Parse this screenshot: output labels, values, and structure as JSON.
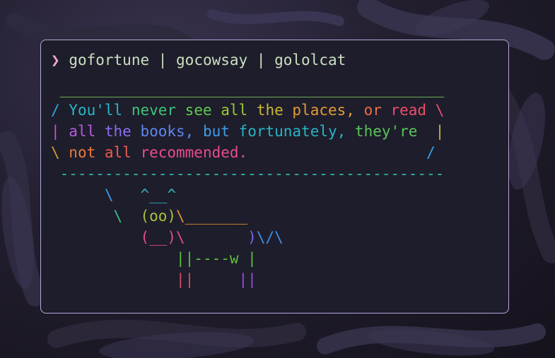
{
  "terminal": {
    "prompt_symbol": "❯",
    "command": "gofortune | gocowsay | gololcat"
  },
  "output_lines": [
    [
      {
        "t": " ",
        "c": "#6ec45a"
      },
      {
        "t": "___________________________________________",
        "c": "#7bc85a"
      }
    ],
    [
      {
        "t": "/ ",
        "c": "#2fa7e6"
      },
      {
        "t": "You'll ",
        "c": "#25b8c8"
      },
      {
        "t": "never ",
        "c": "#3ec67a"
      },
      {
        "t": "see ",
        "c": "#5fca4c"
      },
      {
        "t": "all ",
        "c": "#9bc83a"
      },
      {
        "t": "the ",
        "c": "#c9b833"
      },
      {
        "t": "places, ",
        "c": "#e49a35"
      },
      {
        "t": "or ",
        "c": "#ee6d45"
      },
      {
        "t": "read ",
        "c": "#f04c6a"
      },
      {
        "t": "\\",
        "c": "#f04c7a"
      }
    ],
    [
      {
        "t": "| ",
        "c": "#d94acd"
      },
      {
        "t": "all ",
        "c": "#b85ae0"
      },
      {
        "t": "the ",
        "c": "#8a6df0"
      },
      {
        "t": "books, ",
        "c": "#5f86ef"
      },
      {
        "t": "but ",
        "c": "#3e9ce8"
      },
      {
        "t": "fortunately, ",
        "c": "#26b5c6"
      },
      {
        "t": "they're  ",
        "c": "#57c65a"
      },
      {
        "t": "|",
        "c": "#d2b633"
      }
    ],
    [
      {
        "t": "\\ ",
        "c": "#d89a2f"
      },
      {
        "t": "not ",
        "c": "#ec7a3a"
      },
      {
        "t": "all ",
        "c": "#ef5a52"
      },
      {
        "t": "recommended.",
        "c": "#e84c8e"
      },
      {
        "t": "                    ",
        "c": "#e84c8e"
      },
      {
        "t": "/",
        "c": "#3a9de6"
      }
    ],
    [
      {
        "t": " -------------------------------------------",
        "c": "#2eb7a8"
      }
    ],
    [
      {
        "t": "      \\   ",
        "c": "#3a9de6"
      },
      {
        "t": "^__^",
        "c": "#32b4c4"
      }
    ],
    [
      {
        "t": "       \\  ",
        "c": "#37c08a"
      },
      {
        "t": "(oo)",
        "c": "#a2c43a"
      },
      {
        "t": "\\_______",
        "c": "#e58e33"
      }
    ],
    [
      {
        "t": "          ",
        "c": "#e04c8c"
      },
      {
        "t": "(__)\\",
        "c": "#e04c8c"
      },
      {
        "t": "       ",
        "c": "#8a5ae6"
      },
      {
        "t": ")",
        "c": "#7a63ee"
      },
      {
        "t": "\\/\\",
        "c": "#3f8fe8"
      }
    ],
    [
      {
        "t": "              ",
        "c": "#26c08a"
      },
      {
        "t": "||----w |",
        "c": "#5cc23a"
      }
    ],
    [
      {
        "t": "              ",
        "c": "#e04a6a"
      },
      {
        "t": "||",
        "c": "#e04a6a"
      },
      {
        "t": "     ",
        "c": "#b84ade"
      },
      {
        "t": "||",
        "c": "#9a4ce6"
      }
    ]
  ]
}
